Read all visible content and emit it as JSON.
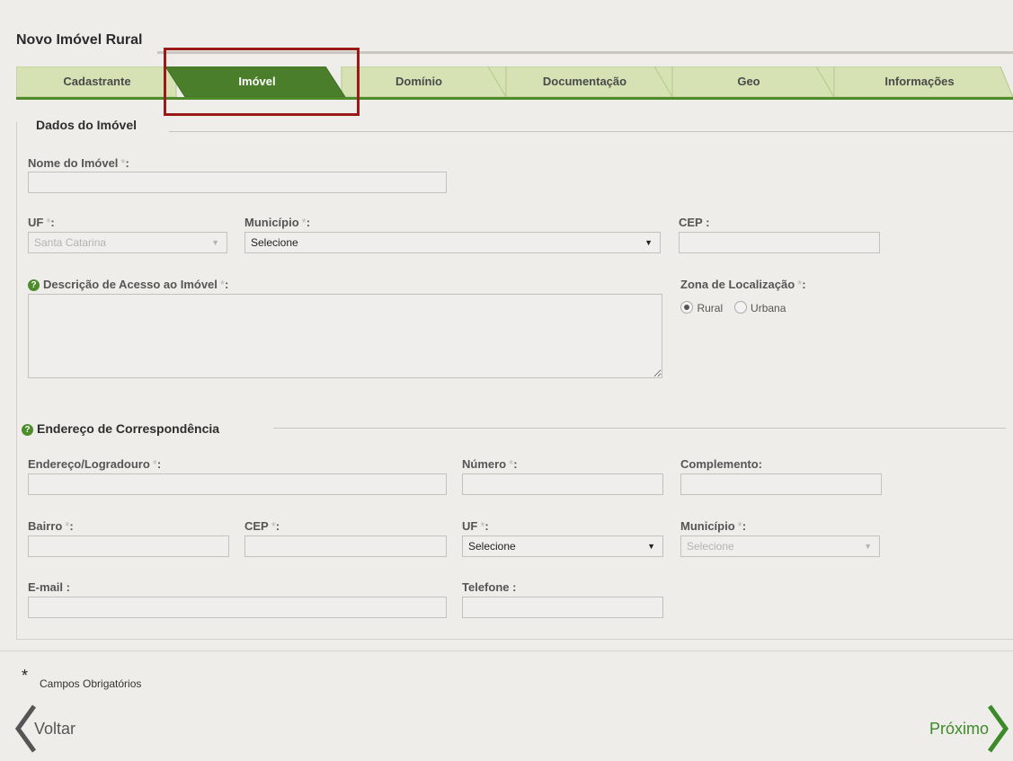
{
  "page": {
    "title": "Novo Imóvel Rural"
  },
  "tabs": [
    {
      "label": "Cadastrante",
      "active": false
    },
    {
      "label": "Imóvel",
      "active": true
    },
    {
      "label": "Domínio",
      "active": false
    },
    {
      "label": "Documentação",
      "active": false
    },
    {
      "label": "Geo",
      "active": false
    },
    {
      "label": "Informações",
      "active": false
    }
  ],
  "colors": {
    "tab_active": "#4a7e2a",
    "tab_inactive": "#d6e2b4",
    "accent": "#4f8a2b",
    "highlight": "#9a1a1a"
  },
  "dados": {
    "section_title": "Dados do Imóvel",
    "nome_label": "Nome do Imóvel",
    "nome_value": "",
    "uf_label": "UF",
    "uf_value": "Santa Catarina",
    "municipio_label": "Município",
    "municipio_value": "Selecione",
    "cep_label": "CEP :",
    "cep_value": "",
    "descricao_label": "Descrição de Acesso ao Imóvel",
    "descricao_value": "",
    "zona_label": "Zona de Localização",
    "zona_options": [
      "Rural",
      "Urbana"
    ],
    "zona_selected": "Rural"
  },
  "endereco": {
    "section_title": "Endereço de Correspondência",
    "logradouro_label": "Endereço/Logradouro",
    "numero_label": "Número",
    "complemento_label": "Complemento:",
    "bairro_label": "Bairro",
    "cep_label": "CEP",
    "uf_label": "UF",
    "uf_value": "Selecione",
    "municipio_label": "Município",
    "municipio_value": "Selecione",
    "email_label": "E-mail :",
    "telefone_label": "Telefone :"
  },
  "footer": {
    "required_star": "*",
    "required_note": "Campos Obrigatórios",
    "back_label": "Voltar",
    "next_label": "Próximo"
  },
  "icons": {
    "help": "help-icon",
    "back": "chevron-left-icon",
    "next": "chevron-right-icon",
    "dropdown": "dropdown-arrow-icon"
  }
}
